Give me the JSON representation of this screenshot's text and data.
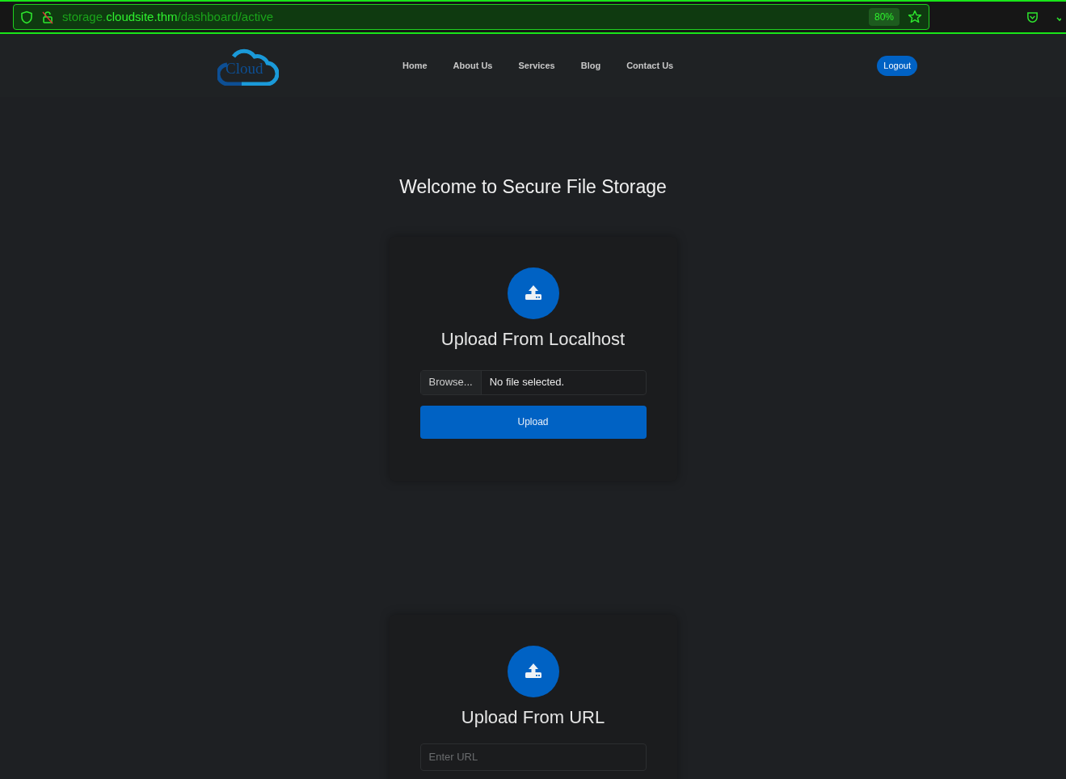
{
  "browser": {
    "url": {
      "subdomain": "storage.",
      "domain": "cloudsite.thm",
      "path": "/dashboard/active"
    },
    "zoom": "80%"
  },
  "nav": {
    "logo": "Cloud",
    "links": [
      "Home",
      "About Us",
      "Services",
      "Blog",
      "Contact Us"
    ],
    "logout": "Logout"
  },
  "heading": "Welcome to Secure File Storage",
  "cards": [
    {
      "kind": "file",
      "title": "Upload From Localhost",
      "browse": "Browse...",
      "file_status": "No file selected.",
      "button": "Upload"
    },
    {
      "kind": "url",
      "title": "Upload From URL",
      "placeholder": "Enter URL"
    }
  ]
}
